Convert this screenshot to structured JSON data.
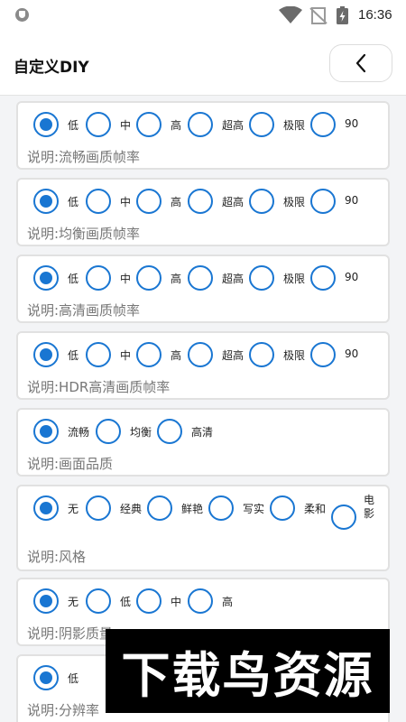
{
  "status_bar": {
    "time": "16:36"
  },
  "header": {
    "title": "自定义DIY"
  },
  "settings": [
    {
      "options": [
        "低",
        "中",
        "高",
        "超高",
        "极限",
        "90"
      ],
      "selected": 0,
      "description": "说明:流畅画质帧率"
    },
    {
      "options": [
        "低",
        "中",
        "高",
        "超高",
        "极限",
        "90"
      ],
      "selected": 0,
      "description": "说明:均衡画质帧率"
    },
    {
      "options": [
        "低",
        "中",
        "高",
        "超高",
        "极限",
        "90"
      ],
      "selected": 0,
      "description": "说明:高清画质帧率"
    },
    {
      "options": [
        "低",
        "中",
        "高",
        "超高",
        "极限",
        "90"
      ],
      "selected": 0,
      "description": "说明:HDR高清画质帧率"
    },
    {
      "options": [
        "流畅",
        "均衡",
        "高清"
      ],
      "selected": 0,
      "description": "说明:画面品质"
    },
    {
      "options": [
        "无",
        "经典",
        "鲜艳",
        "写实",
        "柔和",
        "电影"
      ],
      "selected": 0,
      "description": "说明:风格"
    },
    {
      "options": [
        "无",
        "低",
        "中",
        "高"
      ],
      "selected": 0,
      "description": "说明:阴影质量"
    },
    {
      "options": [
        "低"
      ],
      "selected": 0,
      "description": "说明:分辨率"
    }
  ],
  "watermark": "下载鸟资源",
  "colors": {
    "accent": "#1976d2",
    "card_border": "#e1e1e1",
    "background": "#f3f4f6"
  }
}
